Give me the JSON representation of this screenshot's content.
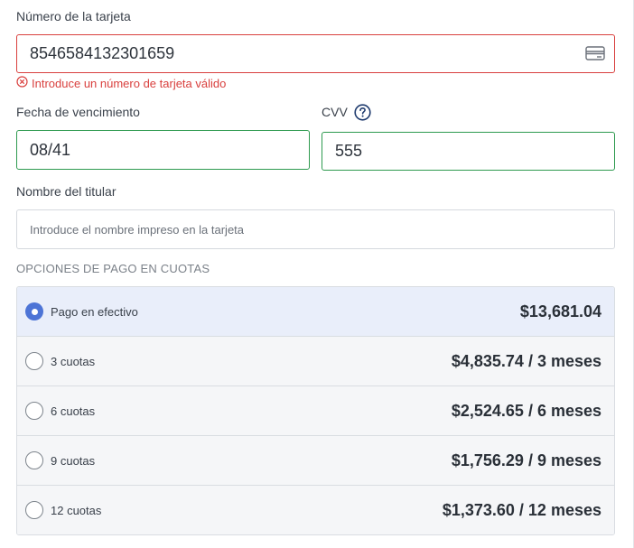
{
  "card_number": {
    "label": "Número de la tarjeta",
    "value": "8546584132301659",
    "icon": "credit-card-icon",
    "error": "Introduce un número de tarjeta válido",
    "error_color": "#d9403e"
  },
  "expiry": {
    "label": "Fecha de vencimiento",
    "value": "08/41"
  },
  "cvv": {
    "label": "CVV",
    "value": "555",
    "help_icon": "question-circle-icon"
  },
  "holder": {
    "label": "Nombre del titular",
    "placeholder": "Introduce el nombre impreso en la tarjeta"
  },
  "installments": {
    "title": "OPCIONES DE PAGO EN CUOTAS",
    "options": [
      {
        "label": "Pago en efectivo",
        "price": "$13,681.04",
        "selected": true
      },
      {
        "label": "3 cuotas",
        "price": "$4,835.74 / 3 meses",
        "selected": false
      },
      {
        "label": "6 cuotas",
        "price": "$2,524.65 / 6 meses",
        "selected": false
      },
      {
        "label": "9 cuotas",
        "price": "$1,756.29 / 9 meses",
        "selected": false
      },
      {
        "label": "12 cuotas",
        "price": "$1,373.60 / 12 meses",
        "selected": false
      }
    ]
  },
  "colors": {
    "valid_border": "#2e9a4f",
    "error_border": "#d9403e",
    "selected_bg": "#e9eefa",
    "radio_selected": "#4d74d6"
  }
}
